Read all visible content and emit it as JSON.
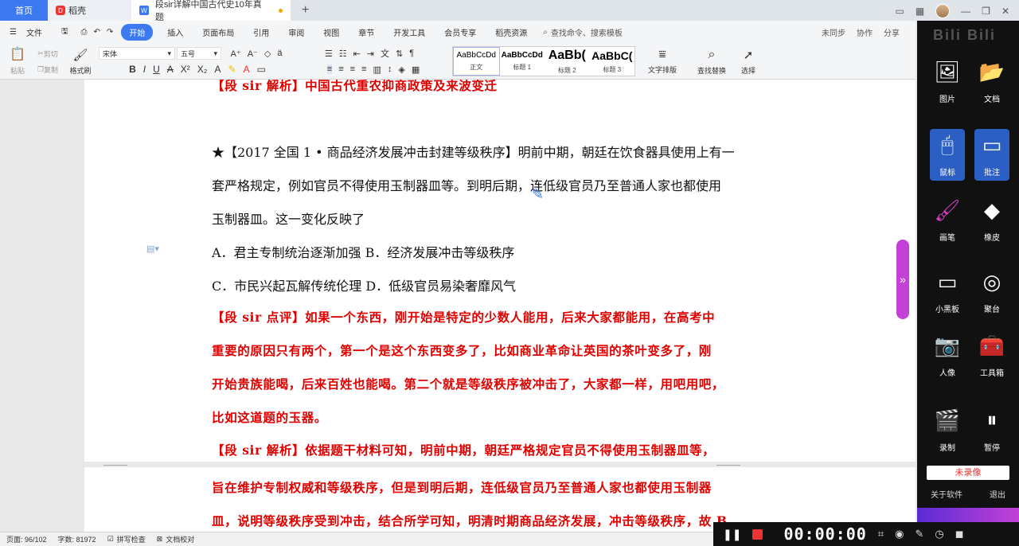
{
  "tabs": {
    "home": "首页",
    "daoke": "稻壳",
    "doc": "段sir详解中国古代史10年真题"
  },
  "menu": {
    "file": "文件",
    "items": [
      "开始",
      "插入",
      "页面布局",
      "引用",
      "审阅",
      "视图",
      "章节",
      "开发工具",
      "会员专享",
      "稻壳资源"
    ],
    "search": "查找命令、搜索模板",
    "not_synced": "未同步",
    "collab": "协作",
    "share": "分享"
  },
  "ribbon": {
    "paste": "粘贴",
    "cut": "剪切",
    "copy": "复制",
    "format_painter": "格式刷",
    "font": "宋体",
    "size": "五号",
    "styles": [
      {
        "preview": "AaBbCcDd",
        "label": "正文"
      },
      {
        "preview": "AaBbCcDd",
        "label": "标题 1"
      },
      {
        "preview": "AaBb(",
        "label": "标题 2"
      },
      {
        "preview": "AaBbC(",
        "label": "标题 3"
      }
    ],
    "text_layout": "文字排版",
    "find_replace": "查找替换",
    "select": "选择"
  },
  "document": {
    "top_partial": "【段 sir 解析】中国古代重农抑商政策及来波变迁",
    "q_line1": "★【2017 全国 1 • 商品经济发展冲击封建等级秩序】明前中期，朝廷在饮食器具使用上有一",
    "q_line2": "套严格规定，例如官员不得使用玉制器皿等。到明后期，连低级官员乃至普通人家也都使用",
    "q_line3": "玉制器皿。这一变化反映了",
    "option_ab": "A．君主专制统治逐渐加强 B．经济发展冲击等级秩序",
    "option_cd": "C．市民兴起瓦解传统伦理 D．低级官员易染奢靡风气",
    "comment1": "【段 sir 点评】如果一个东西，刚开始是特定的少数人能用，后来大家都能用，在高考中",
    "comment2": "重要的原因只有两个，第一个是这个东西变多了，比如商业革命让英国的茶叶变多了，刚",
    "comment3": "开始贵族能喝，后来百姓也能喝。第二个就是等级秩序被冲击了，大家都一样，用吧用吧，",
    "comment4": "比如这道题的玉器。",
    "analysis1": "【段 sir 解析】依据题干材料可知，明前中期，朝廷严格规定官员不得使用玉制器皿等，",
    "analysis2": "旨在维护专制权威和等级秩序，但是到明后期，连低级官员乃至普通人家也都使用玉制器",
    "analysis3": "皿，说明等级秩序受到冲击，结合所学可知，明清时期商品经济发展，冲击等级秩序，故 B"
  },
  "status": {
    "page": "页面: 96/102",
    "words": "字数: 81972",
    "spell": "拼写检查",
    "proof": "文档校对"
  },
  "recorder": {
    "timer": "00:00:00"
  },
  "panel": {
    "brand": "Bili Bili",
    "buttons": [
      "图片",
      "文档",
      "鼠标",
      "批注",
      "画笔",
      "橡皮",
      "小黑板",
      "聚台",
      "人像",
      "工具箱",
      "录制",
      "暂停"
    ],
    "not_recording": "未录像",
    "about": "关于软件",
    "exit": "退出"
  }
}
